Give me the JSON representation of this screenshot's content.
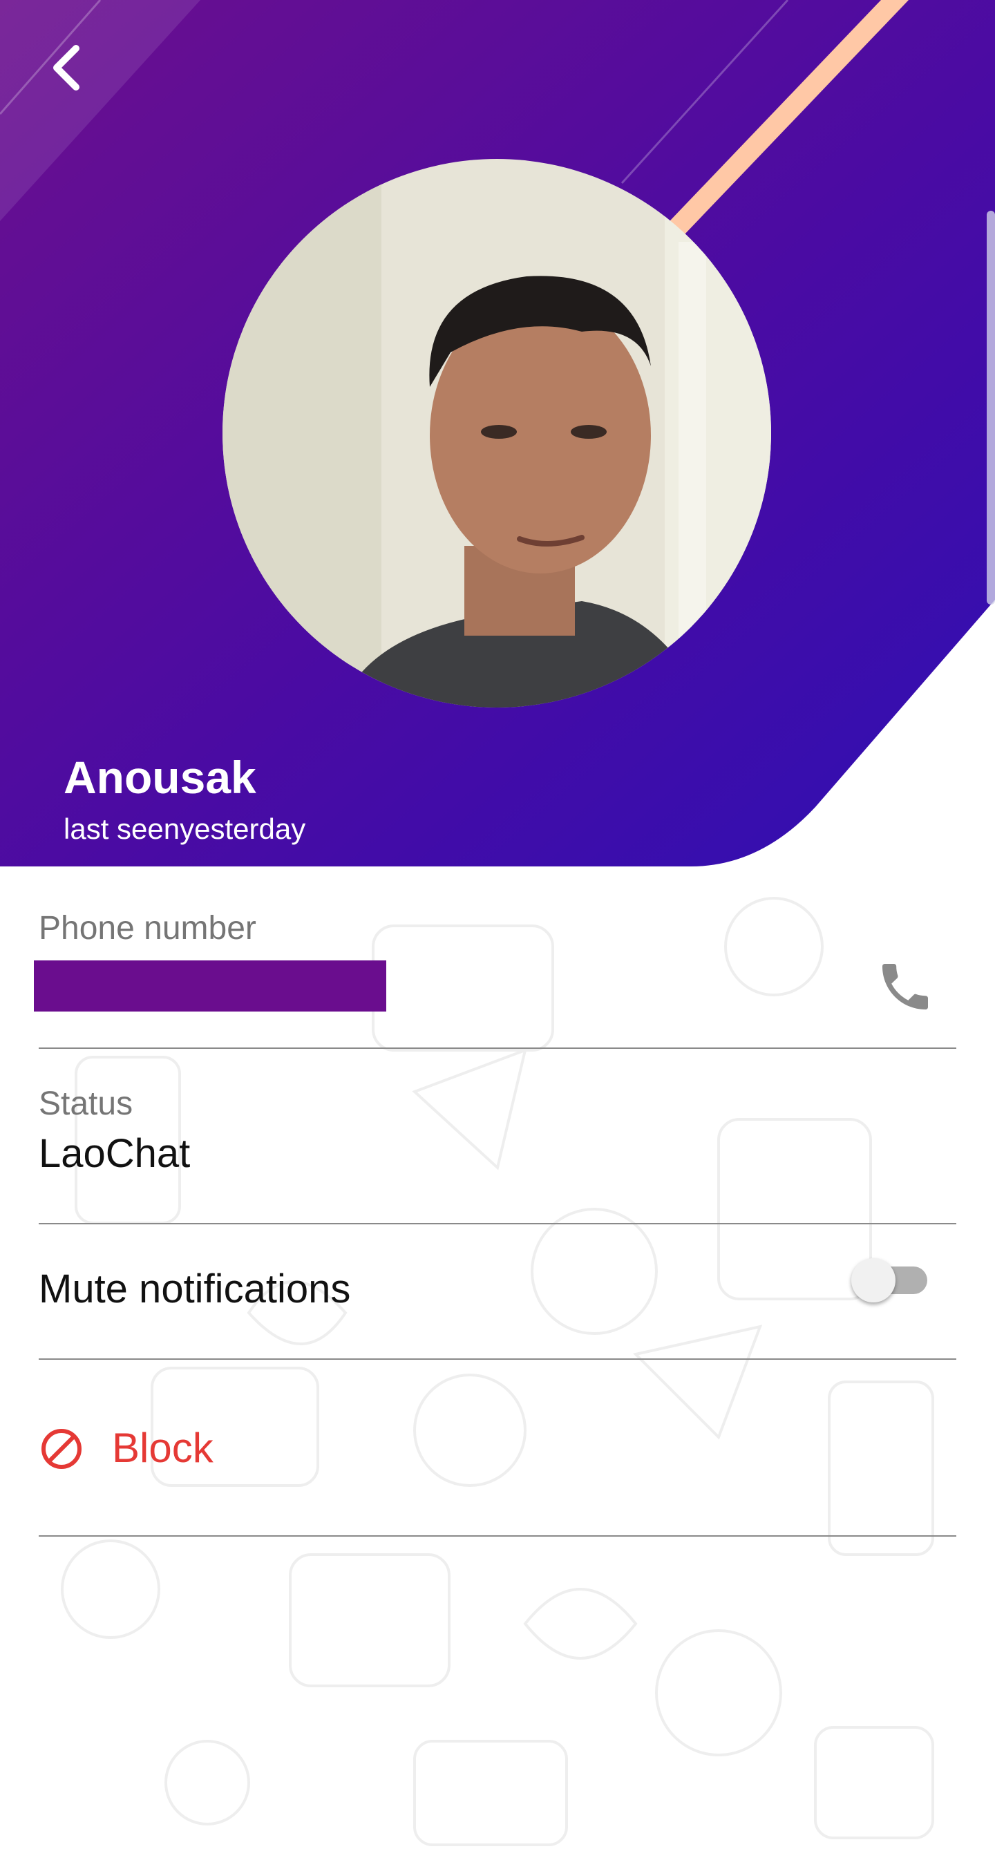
{
  "header": {
    "back_icon": "chevron-left-icon",
    "name": "Anousak",
    "last_seen": "last seenyesterday",
    "colors": {
      "gradient_start": "#6b0f8e",
      "gradient_end": "#2f0fb3",
      "accent_stripe": "#ffc8a6"
    }
  },
  "fields": {
    "phone_label": "Phone number",
    "phone_icon": "phone-icon",
    "status_label": "Status",
    "status_value": "LaoChat",
    "mute_label": "Mute notifications",
    "mute_enabled": false,
    "block_label": "Block",
    "block_icon": "block-icon",
    "block_color": "#e53935"
  }
}
